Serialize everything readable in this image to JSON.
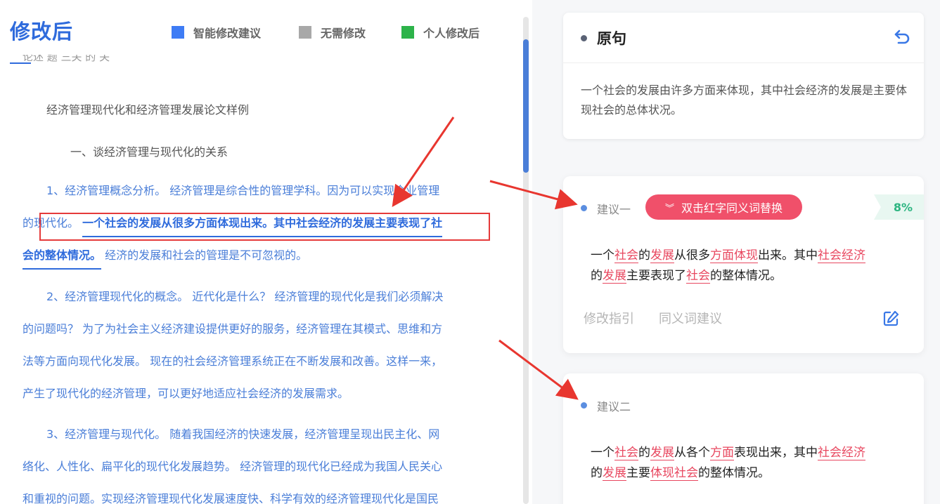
{
  "header": {
    "title": "修改后",
    "legend": [
      {
        "label": "智能修改建议",
        "color": "#3e7cf5"
      },
      {
        "label": "无需修改",
        "color": "#a8a8a8"
      },
      {
        "label": "个人修改后",
        "color": "#2db34a"
      }
    ]
  },
  "document": {
    "cut_line": "论述 题 三关 的 关",
    "title": "经济管理现代化和经济管理发展论文样例",
    "section": "一、谈经济管理与现代化的关系",
    "para1": {
      "line1": "1、经济管理概念分析。 经济管理是综合性的管理学科。因为可以实现企业管理",
      "line2_pre": "的现代化。 ",
      "line2_hl": "一个社会的发展从很多方面体现出来。其中社会经济的发展主要表现了社",
      "line3_hl": "会的整体情况。",
      "line3_post": " 经济的发展和社会的管理是不可忽视的。"
    },
    "para2": {
      "line1": "2、经济管理现代化的概念。 近代化是什么？ 经济管理的现代化是我们必须解决",
      "line2": "的问题吗？ 为了为社会主义经济建设提供更好的服务，经济管理在其模式、思维和方",
      "line3": "法等方面向现代化发展。 现在的社会经济管理系统正在不断发展和改善。这样一来，",
      "line4": "产生了现代化的经济管理，可以更好地适应社会经济的发展需求。"
    },
    "para3": {
      "line1": "3、经济管理与现代化。 随着我国经济的快速发展，经济管理呈现出民主化、网",
      "line2": "络化、人性化、扁平化的现代化发展趋势。 经济管理的现代化已经成为我国人民关心",
      "line3": "和重视的问题。实现经济管理现代化发展速度快、科学有效的经济管理现代化是国民"
    }
  },
  "original": {
    "title": "原句",
    "text": "一个社会的发展由许多方面来体现，其中社会经济的发展是主要体现社会的总体状况。",
    "undo_icon": "undo-icon"
  },
  "suggestion1": {
    "label": "建议一",
    "replace_button": "双击红字同义词替换",
    "percent": "8%",
    "parts": [
      "一个",
      "社会",
      "的",
      "发展",
      "从很多",
      "方面体现",
      "出来。其中",
      "社会经济",
      "的",
      "发展",
      "主要表现了",
      "社会",
      "的整体情况。"
    ],
    "guide_link": "修改指引",
    "synonym_link": "同义词建议",
    "edit_icon": "edit-icon"
  },
  "suggestion2": {
    "label": "建议二",
    "parts": [
      "一个",
      "社会",
      "的",
      "发展",
      "从各个",
      "方面",
      "表现出来，其中",
      "社会经济",
      "的",
      "发展",
      "主要",
      "体现社会",
      "的整体情况。"
    ]
  }
}
